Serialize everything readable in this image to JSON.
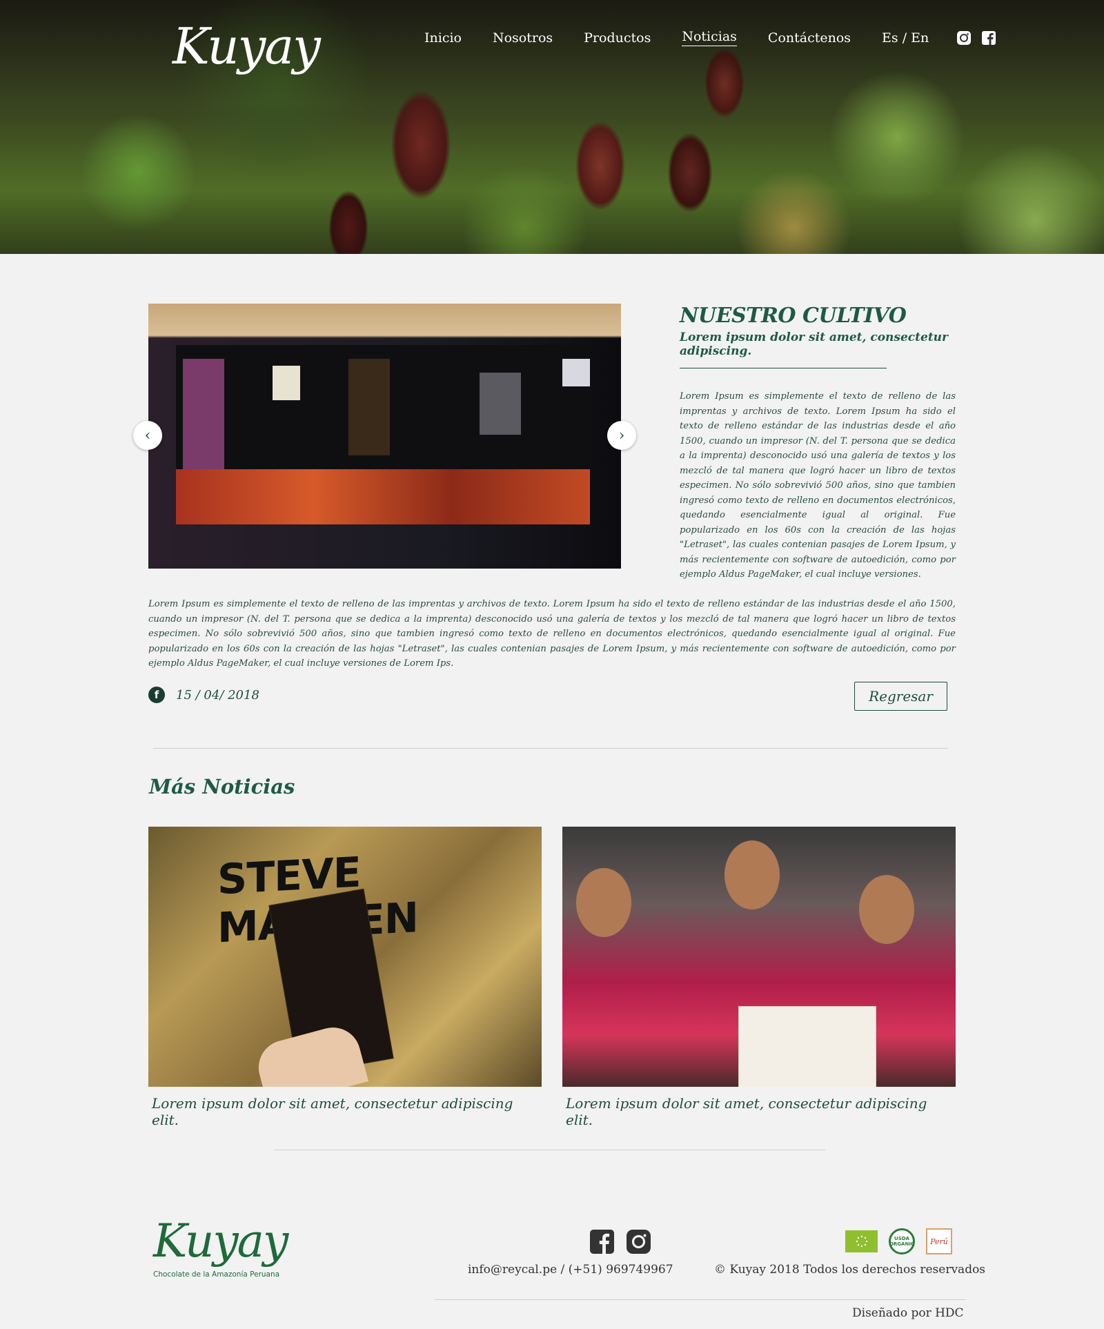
{
  "header": {
    "logo_text": "Kuyay",
    "nav": [
      {
        "label": "Inicio"
      },
      {
        "label": "Nosotros"
      },
      {
        "label": "Productos"
      },
      {
        "label": "Noticias"
      },
      {
        "label": "Contáctenos"
      }
    ],
    "active_nav": "Noticias",
    "lang_label": "Es / En",
    "social_icons": [
      "instagram-icon",
      "facebook-icon"
    ]
  },
  "article": {
    "title": "NUESTRO CULTIVO",
    "subtitle": "Lorem ipsum dolor sit amet, consectetur adipiscing.",
    "side_text": "Lorem Ipsum es simplemente el texto de relleno de las imprentas y archivos de texto. Lorem Ipsum ha sido el texto de relleno estándar de las industrias desde el año 1500, cuando un impresor (N. del T. persona que se dedica a la imprenta) desconocido usó una galería de textos y los mezcló de tal manera que logró hacer un libro de textos especimen. No sólo sobrevivió 500 años, sino que tambien ingresó como texto de relleno en documentos electrónicos, quedando esencialmente igual al original. Fue popularizado en los 60s con la creación de las hojas \"Letraset\", las cuales contenian pasajes de Lorem Ipsum, y más recientemente con software de autoedición, como por ejemplo Aldus PageMaker, el cual incluye versiones.",
    "body_text": "Lorem Ipsum es simplemente el texto de relleno de las imprentas y archivos de texto. Lorem Ipsum ha sido el texto de relleno estándar de las industrias desde el año 1500, cuando un impresor (N. del T. persona que se dedica a la imprenta) desconocido usó una galería de textos y los mezcló de tal manera que logró hacer un libro de textos especimen. No sólo sobrevivió 500 años, sino que tambien ingresó como texto de relleno en documentos electrónicos, quedando esencialmente igual al original. Fue popularizado en los 60s con la creación de las hojas \"Letraset\", las cuales contenian pasajes de Lorem Ipsum, y más recientemente con software de autoedición, como por ejemplo Aldus PageMaker, el cual incluye versiones de Lorem Ips.",
    "date": "15 / 04/ 2018",
    "fb_glyph": "f",
    "back_label": "Regresar",
    "slider": {
      "prev_glyph": "‹",
      "next_glyph": "›"
    }
  },
  "more_news": {
    "title": "Más Noticias",
    "cards": [
      {
        "caption": "Lorem ipsum dolor sit amet, consectetur adipiscing elit.",
        "image_text": "STEVE MADDEN"
      },
      {
        "caption": "Lorem ipsum dolor sit amet, consectetur adipiscing elit."
      }
    ]
  },
  "footer": {
    "logo_text": "Kuyay",
    "tagline": "Chocolate de la Amazonía Peruana",
    "contact": "info@reycal.pe / (+51) 969749967",
    "copyright": "© Kuyay 2018 Todos los derechos reservados",
    "designed_by": "Diseñado por HDC",
    "badges": {
      "usda": "USDA ORGANIC",
      "peru": "Perú"
    }
  },
  "colors": {
    "brand_green": "#1f4d3b",
    "background": "#f2f2f2"
  }
}
